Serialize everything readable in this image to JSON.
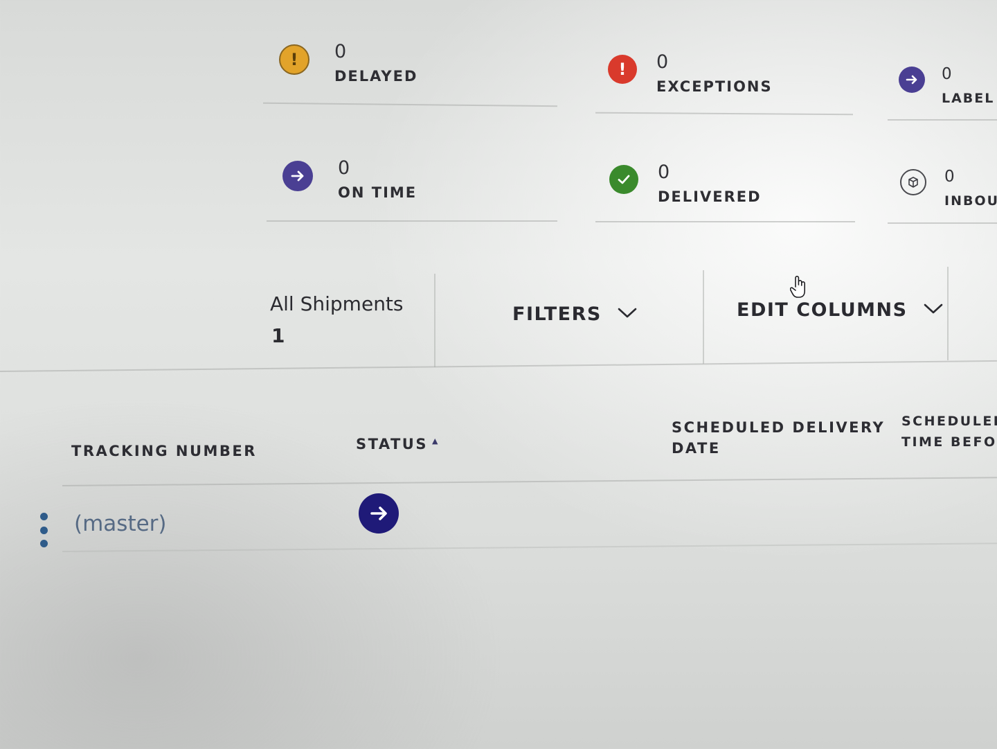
{
  "summary": {
    "delayed": {
      "count": "0",
      "label": "DELAYED",
      "icon": "exclamation-icon",
      "color": "#e2a32a"
    },
    "exceptions": {
      "count": "0",
      "label": "EXCEPTIONS",
      "icon": "exclamation-icon",
      "color": "#d93a2c"
    },
    "label_created": {
      "count": "0",
      "label": "LABEL C",
      "icon": "arrow-right-icon",
      "color": "#4a3f93"
    },
    "on_time": {
      "count": "0",
      "label": "ON TIME",
      "icon": "arrow-right-icon",
      "color": "#4a3f93"
    },
    "delivered": {
      "count": "0",
      "label": "DELIVERED",
      "icon": "checkmark-icon",
      "color": "#3a8a2c"
    },
    "inbound": {
      "count": "0",
      "label": "INBOUN",
      "icon": "package-icon",
      "color": "#4a4a4f"
    }
  },
  "toolbar": {
    "view_title": "All Shipments",
    "view_count": "1",
    "filters_label": "FILTERS",
    "edit_columns_label": "EDIT COLUMNS"
  },
  "table": {
    "columns": {
      "tracking_number": "TRACKING NUMBER",
      "status": "STATUS",
      "scheduled_delivery_line1": "SCHEDULED DELIVERY",
      "scheduled_delivery_line2": "DATE",
      "scheduled_time_line1": "SCHEDULED",
      "scheduled_time_line2": "TIME BEFORE"
    },
    "sort_indicator": "▲",
    "rows": [
      {
        "tracking": "(master)",
        "status_icon": "arrow-right-icon",
        "status_color": "#1f1a78"
      }
    ]
  }
}
